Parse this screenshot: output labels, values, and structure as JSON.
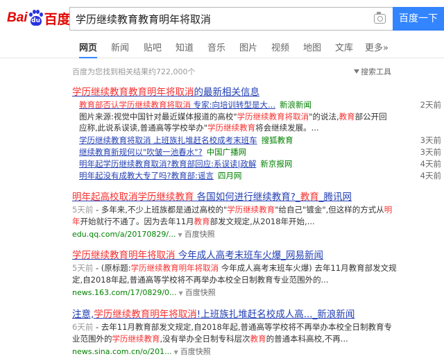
{
  "logo": {
    "text_bai": "Bai",
    "text_du": "du",
    "text_baidu": "百度",
    "paw_text": "du"
  },
  "search": {
    "query": "学历继续教育教育明年将取消",
    "button_label": "百度一下"
  },
  "tabs": [
    "网页",
    "新闻",
    "贴吧",
    "知道",
    "音乐",
    "图片",
    "视频",
    "地图",
    "文库",
    "更多»"
  ],
  "info": {
    "count_text": "百度为您找到相关结果约722,000个",
    "tools_label": "搜索工具"
  },
  "news": {
    "title_em": "学历继续教育教育明年将取消",
    "title_rest": "的最新相关信息",
    "top_link_em": "教育部否认学历继续教育将取消",
    "top_link_rest": " 专家:向培训转型是大...",
    "top_source": "新浪新闻",
    "top_time": "2天前",
    "desc_parts": [
      "图片来源:视觉中国针对最近媒体报道的高校\"",
      "学历继续教育将取消",
      "\"的说法,",
      "教育",
      "部公开回应称,此说系误读,普通高等学校举办\"",
      "学历继续教育",
      "将会继续发展。..."
    ],
    "items": [
      {
        "link": "学历继续教育将取消 上班族扎堆赶名校成考末班车",
        "source": "搜狐教育",
        "time": "3天前"
      },
      {
        "link": "继续教育新规何以\"吹皱一池春水\"?",
        "source": "中国广播网",
        "time": "3天前"
      },
      {
        "link": "明年起学历继续教育取消?教育部回应:系误读|政解",
        "source": "新京报网",
        "time": "4天前"
      },
      {
        "link": "明年起没有成教大专了吗?教育部:谣言",
        "source": "四月网",
        "time": "4天前"
      }
    ]
  },
  "results": [
    {
      "title_parts": [
        "明年起高校取消学历继续教育",
        " 各国如何进行继续教育?_",
        "教育",
        "_腾讯网"
      ],
      "time": "5天前",
      "abs_parts": [
        " - 多年来,不少上班族都是通过高校的\"",
        "学历继续教育",
        "\"给自己\"镀金\",但这样的方式从",
        "明年",
        "开始就行不通了。因为去年11月",
        "教育",
        "部发文规定,从2018年开始,..."
      ],
      "url": "edu.qq.com/a/20170829/...",
      "snapshot": "百度快照"
    },
    {
      "title_parts": [
        "学历继续教育明年将取消",
        " 今年成人高考末班车火爆_网易新闻"
      ],
      "time": "5天前",
      "abs_parts": [
        " - (原标题:",
        "学历继续教育明年将取消",
        " 今年成人高考末班车火爆) 去年11月教育部发文规定,自2018年起,普通高等学校将不再举办本校全日制教育专业范围外的..."
      ],
      "url": "news.163.com/17/0829/0...",
      "snapshot": "百度快照"
    },
    {
      "title_parts": [
        "注意,",
        "学历继续教育明年将取消",
        "!上班族扎堆赶名校成人高..._新浪新闻"
      ],
      "time": "6天前",
      "abs_parts": [
        " - 去年11月教育部发文规定,自2018年起,普通高等学校将不再举办本校全日制教育专业范围外的",
        "学历继续教育",
        ",没有举办全日制专科层次",
        "教育",
        "的普通本科高校,不再..."
      ],
      "url": "news.sina.com.cn/o/201...",
      "snapshot": "百度快照"
    }
  ]
}
